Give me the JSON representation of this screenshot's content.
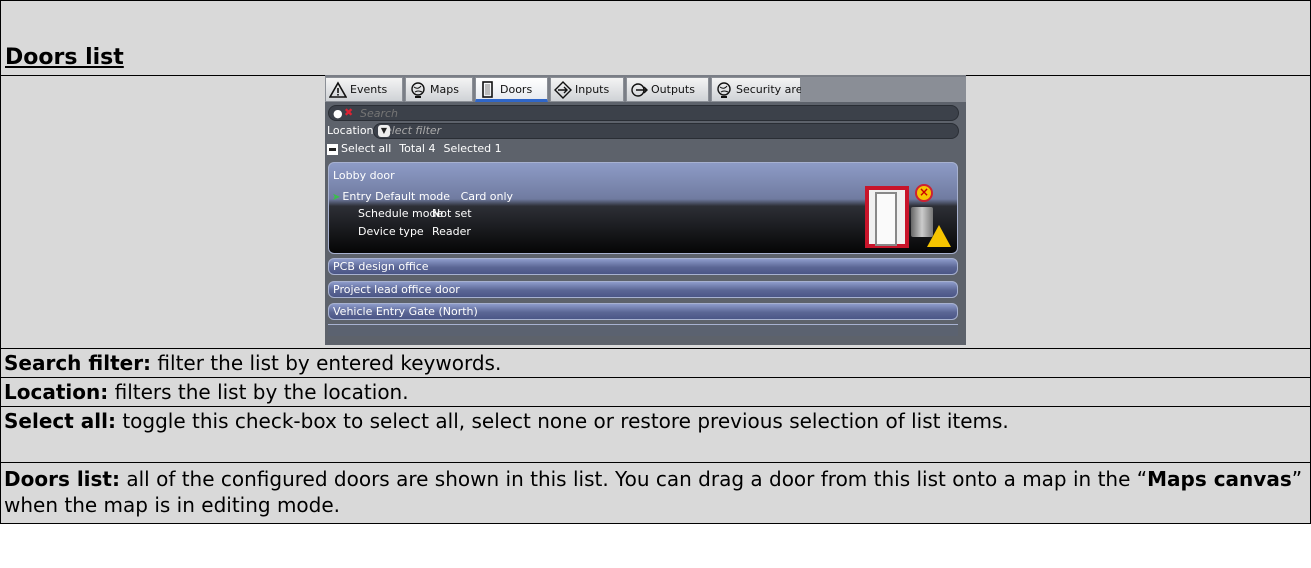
{
  "document": {
    "title": "Doors list",
    "descriptions": [
      {
        "term": "Search filter:",
        "text": " filter the list by entered keywords."
      },
      {
        "term": "Location:",
        "text": " filters the list by the location."
      },
      {
        "term": "Select all:",
        "text": " toggle this check-box to select all, select none or restore previous selection of list items."
      },
      {
        "term": "Doors list:",
        "text_before": " all of the configured doors are shown in this list. You can drag a door from this list onto a map in the “",
        "emphasis": "Maps canvas",
        "text_after": "” when the map is in editing mode."
      }
    ]
  },
  "app": {
    "tabs": [
      {
        "label": "Events",
        "icon": "warning-icon"
      },
      {
        "label": "Maps",
        "icon": "globe-icon"
      },
      {
        "label": "Doors",
        "icon": "door-icon",
        "active": true
      },
      {
        "label": "Inputs",
        "icon": "input-arrow-icon"
      },
      {
        "label": "Outputs",
        "icon": "output-arrow-icon"
      },
      {
        "label": "Security areas",
        "icon": "globe-icon"
      }
    ],
    "search": {
      "placeholder": "Search"
    },
    "location": {
      "label": "Location",
      "placeholder": "Select filter"
    },
    "selection": {
      "select_all_label": "Select all",
      "total": "Total 4",
      "selected": "Selected 1"
    },
    "doors": [
      {
        "name": "Lobby door",
        "entry": "Entry",
        "expanded": true,
        "details": [
          {
            "key": "Default mode",
            "value": "Card only"
          },
          {
            "key": "Schedule mode",
            "value": "Not set"
          },
          {
            "key": "Device type",
            "value": "Reader"
          }
        ]
      },
      {
        "name": "PCB design office"
      },
      {
        "name": "Project lead office door"
      },
      {
        "name": "Vehicle Entry Gate (North)"
      }
    ],
    "colors": {
      "active_tab_underline": "#2f66c8",
      "door_frame_alarm": "#c8142a",
      "row_blue": "#5b6695"
    }
  }
}
